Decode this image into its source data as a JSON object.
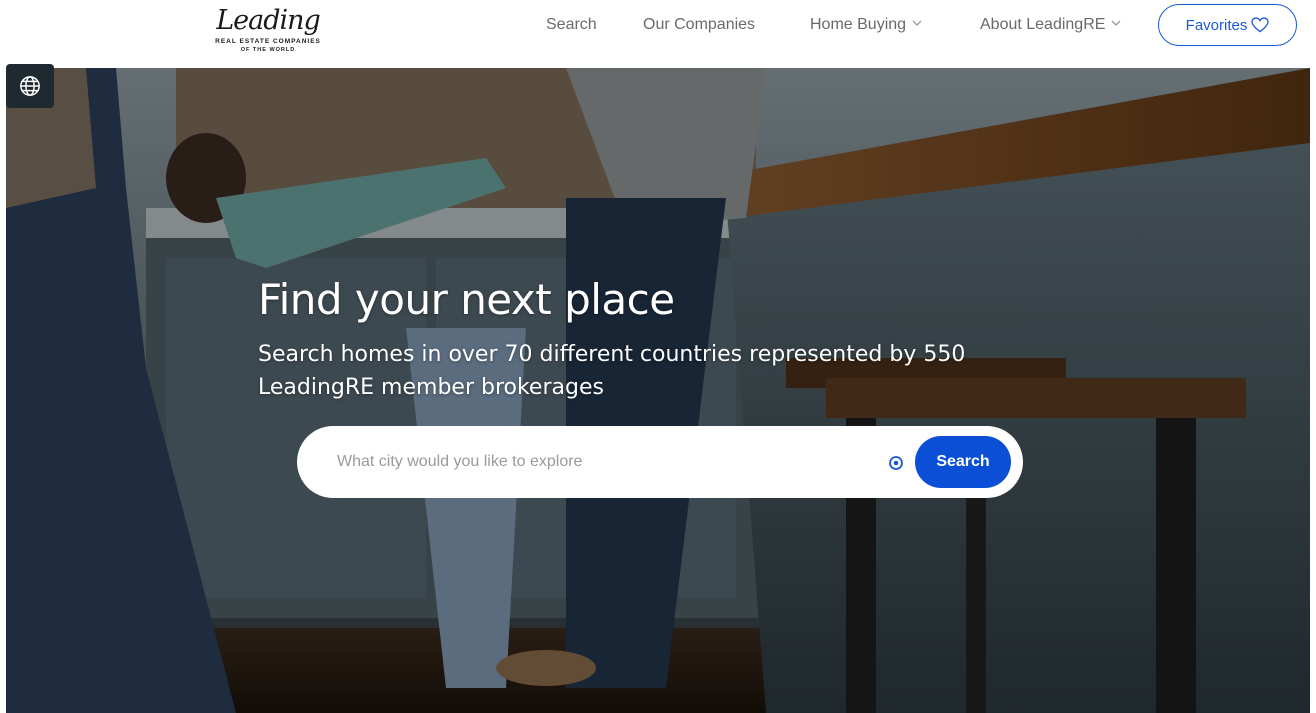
{
  "header": {
    "logo": {
      "script_text": "Leading",
      "line1": "REAL ESTATE COMPANIES",
      "line2": "OF THE WORLD"
    },
    "nav": [
      {
        "label": "Search",
        "has_dropdown": false
      },
      {
        "label": "Our Companies",
        "has_dropdown": false
      },
      {
        "label": "Home Buying",
        "has_dropdown": true
      },
      {
        "label": "About LeadingRE",
        "has_dropdown": true
      }
    ],
    "favorites_label": "Favorites",
    "favorites_icon": "heart-icon"
  },
  "language_icon": "globe-icon",
  "hero": {
    "title": "Find your next place",
    "subtitle": "Search homes in over 70 different countries represented by 550 LeadingRE member brokerages",
    "search": {
      "placeholder": "What city would you like to explore",
      "value": "",
      "location_icon": "target-location-icon",
      "button_label": "Search"
    }
  },
  "colors": {
    "accent": "#0b4fd6",
    "nav_text": "#6a6a6a",
    "favorites_border": "#1a5ad8"
  }
}
